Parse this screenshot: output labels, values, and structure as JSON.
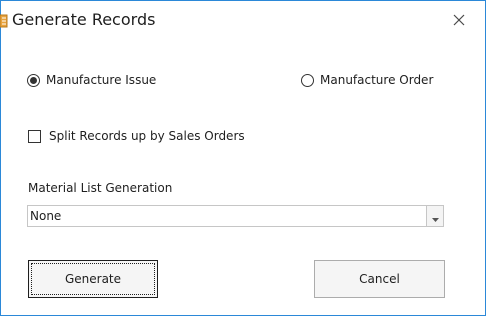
{
  "window": {
    "title": "Generate Records",
    "icon": "record-document-icon",
    "close_icon": "close-icon"
  },
  "options": {
    "issue_label": "Manufacture Issue",
    "issue_selected": true,
    "order_label": "Manufacture Order",
    "order_selected": false
  },
  "split": {
    "label": "Split Records up by Sales Orders",
    "checked": false
  },
  "material_list": {
    "label": "Material List Generation",
    "selected_value": "None",
    "dropdown_icon": "dropdown-arrow-icon"
  },
  "buttons": {
    "generate_label": "Generate",
    "cancel_label": "Cancel"
  },
  "colors": {
    "window_border": "#2b88d8",
    "icon_orange": "#e8a33d",
    "text": "#1e1e1e",
    "button_face": "#f5f5f5"
  }
}
